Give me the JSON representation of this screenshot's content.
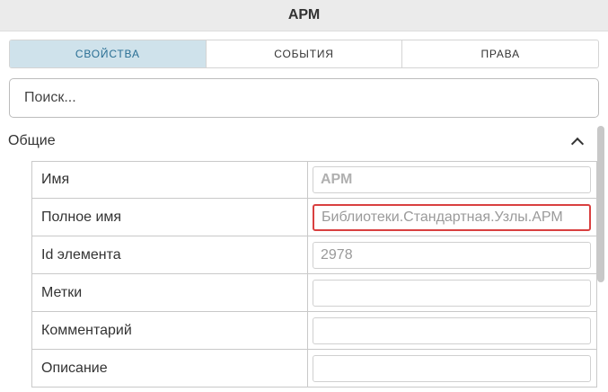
{
  "window": {
    "title": "АРМ"
  },
  "tabs": [
    {
      "label": "СВОЙСТВА",
      "active": true
    },
    {
      "label": "СОБЫТИЯ",
      "active": false
    },
    {
      "label": "ПРАВА",
      "active": false
    }
  ],
  "search": {
    "placeholder": "Поиск..."
  },
  "section": {
    "title": "Общие",
    "icon": "chevron-up-icon"
  },
  "properties": [
    {
      "label": "Имя",
      "value": "АРМ"
    },
    {
      "label": "Полное имя",
      "value": "Библиотеки.Стандартная.Узлы.АРМ"
    },
    {
      "label": "Id элемента",
      "value": "2978"
    },
    {
      "label": "Метки",
      "value": ""
    },
    {
      "label": "Комментарий",
      "value": ""
    },
    {
      "label": "Описание",
      "value": ""
    }
  ],
  "colors": {
    "active_tab_bg": "#cfe2eb",
    "active_tab_text": "#2a6f94",
    "highlight_border": "#d94040"
  }
}
